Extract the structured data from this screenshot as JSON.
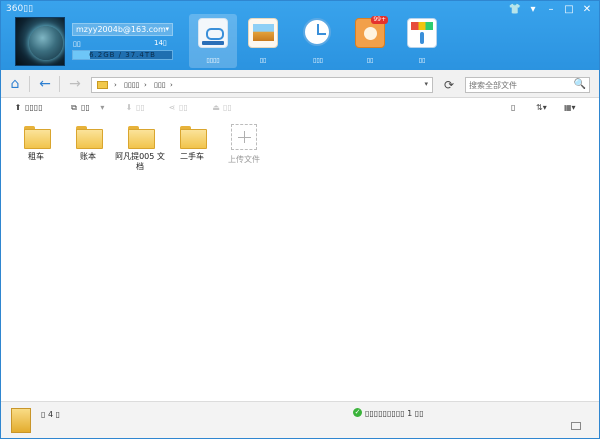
{
  "app": {
    "title": "360▯▯"
  },
  "window_controls": {
    "skin": "👕",
    "menu": "▾",
    "minimize": "–",
    "maximize": "□",
    "close": "✕"
  },
  "account": {
    "email": "mzyy2004b@163.com",
    "dropdown": "▾",
    "vip_label": "▯▯",
    "count_label": "14▯",
    "quota_text": "6.2GB / 37.4TB",
    "quota_fraction": 0.17
  },
  "nav_tabs": [
    {
      "label": "▯▯▯▯",
      "icon": "cloud-disk-icon"
    },
    {
      "label": "▯▯",
      "icon": "photo-album-icon"
    },
    {
      "label": "▯▯▯",
      "icon": "history-clock-icon"
    },
    {
      "label": "▯▯",
      "icon": "people-share-icon",
      "badge": "99+"
    },
    {
      "label": "▯▯",
      "icon": "toolbox-icon"
    }
  ],
  "addressbar": {
    "home": "⌂",
    "back": "←",
    "forward": "→",
    "path": [
      "▯▯▯▯",
      "▯▯▯"
    ],
    "path_sep": "›",
    "dropdown": "▾",
    "refresh": "⟳",
    "search_placeholder": "搜索全部文件",
    "search_icon": "🔍"
  },
  "toolbar": {
    "upload": "▯▯▯▯",
    "new": "▯▯",
    "download": "▯▯",
    "share": "▯▯",
    "more": "▯▯",
    "view_preview": "▯",
    "sort": "⇅▾",
    "view_mode": "▦▾"
  },
  "files": [
    {
      "name": "租车"
    },
    {
      "name": "账本"
    },
    {
      "name": "阿凡提005 文档"
    },
    {
      "name": "二手车"
    }
  ],
  "upload_tile": {
    "label": "上传文件"
  },
  "statusbar": {
    "item_count": "▯ 4 ▯",
    "check": "✓",
    "message": "▯▯▯▯▯▯▯▯▯ 1 ▯▯"
  }
}
